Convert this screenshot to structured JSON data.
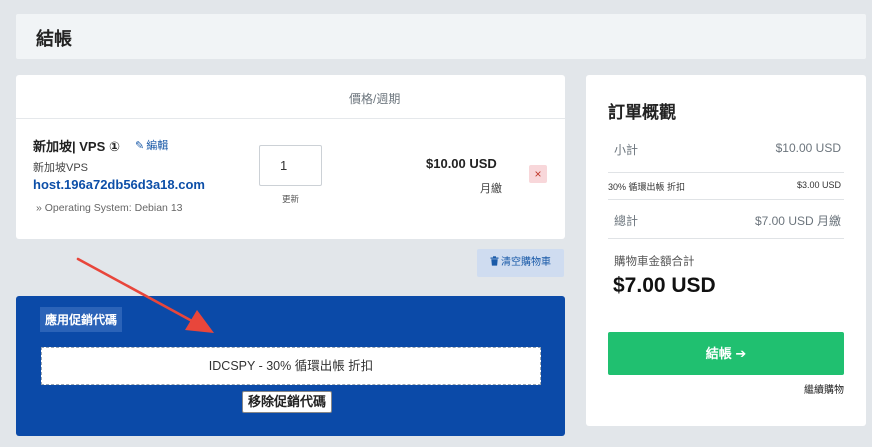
{
  "header": {
    "title": "結帳"
  },
  "cart": {
    "column_header": "價格/週期",
    "item": {
      "name": "新加坡| VPS ①",
      "edit_label": "編輯",
      "group": "新加坡VPS",
      "hostname": "host.196a72db56d3a18.com",
      "os": "» Operating System: Debian 13",
      "quantity": "1",
      "update_label": "更新",
      "price": "$10.00 USD",
      "period": "月繳",
      "remove_icon": "×"
    },
    "empty_cart_label": "清空購物車"
  },
  "promo": {
    "title": "應用促銷代碼",
    "applied_code": "IDCSPY - 30% 循環出帳 折扣",
    "remove_label": "移除促銷代碼"
  },
  "summary": {
    "title": "訂單概觀",
    "subtotal_label": "小計",
    "subtotal_value": "$10.00 USD",
    "discount_label": "30% 循環出帳 折扣",
    "discount_value": "$3.00 USD",
    "total_label": "總計",
    "total_value": "$7.00 USD 月繳",
    "cart_total_label": "購物車金額合計",
    "cart_total_value": "$7.00 USD",
    "checkout_label": "結帳 ➔",
    "continue_label": "繼續購物"
  },
  "icons": {
    "edit": "pencil-icon",
    "remove": "close-icon",
    "trash": "trash-icon",
    "arrow": "arrow-right-icon"
  },
  "colors": {
    "promo_bg": "#0b4aa8",
    "checkout_green": "#20c070",
    "annotation_red": "#e8463b",
    "link_blue": "#0d4fa8"
  }
}
